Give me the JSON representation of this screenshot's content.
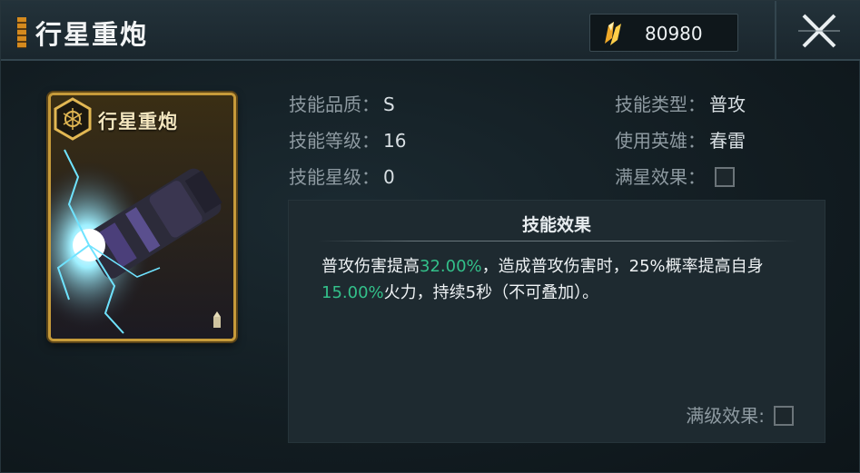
{
  "header": {
    "title": "行星重炮",
    "currency": {
      "icon": "gold-crystal-icon",
      "value": "80980"
    },
    "close_icon": "close-x-icon"
  },
  "card": {
    "name": "行星重炮",
    "badge_icon": "hexagon-shield-icon",
    "art": "planet-cannon-lightning-art",
    "corner_icon": "bullet-icon"
  },
  "info": {
    "quality_label": "技能品质：",
    "quality_value": "S",
    "level_label": "技能等级：",
    "level_value": "16",
    "star_label": "技能星级：",
    "star_value": "0",
    "type_label": "技能类型：",
    "type_value": "普攻",
    "hero_label": "使用英雄：",
    "hero_value": "春雷",
    "fullstar_label": "满星效果："
  },
  "effect": {
    "title": "技能效果",
    "p1": "普攻伤害提高",
    "v1": "32.00%",
    "p2": "，造成普攻伤害时，25%概率提高自身",
    "v2": "15.00%",
    "p3": "火力，持续5秒（不可叠加）。",
    "maxlevel_label": "满级效果:"
  },
  "colors": {
    "accent_gold": "#c69a3a",
    "highlight_green": "#33c08a",
    "label_gray": "#8e9aa1"
  }
}
